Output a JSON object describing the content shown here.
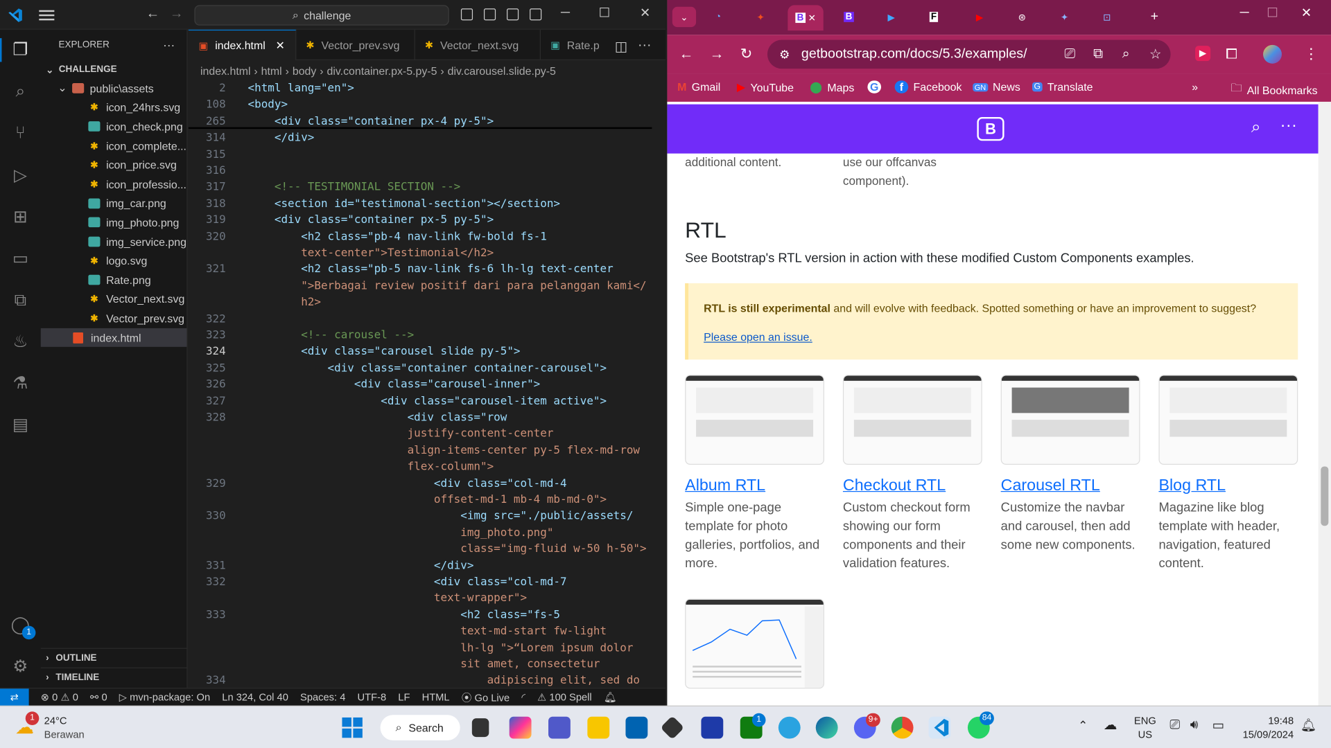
{
  "vscode": {
    "search": "challenge",
    "explorer_title": "EXPLORER",
    "explorer_more": "···",
    "section": "CHALLENGE",
    "folder": "public\\assets",
    "files": [
      {
        "name": "icon_24hrs.svg",
        "kind": "svg"
      },
      {
        "name": "icon_check.png",
        "kind": "png"
      },
      {
        "name": "icon_complete...",
        "kind": "svg"
      },
      {
        "name": "icon_price.svg",
        "kind": "svg"
      },
      {
        "name": "icon_professio...",
        "kind": "svg"
      },
      {
        "name": "img_car.png",
        "kind": "png"
      },
      {
        "name": "img_photo.png",
        "kind": "png"
      },
      {
        "name": "img_service.png",
        "kind": "png"
      },
      {
        "name": "logo.svg",
        "kind": "svg"
      },
      {
        "name": "Rate.png",
        "kind": "png"
      },
      {
        "name": "Vector_next.svg",
        "kind": "svg"
      },
      {
        "name": "Vector_prev.svg",
        "kind": "svg"
      }
    ],
    "root_file": "index.html",
    "outline": "OUTLINE",
    "timeline": "TIMELINE",
    "tabs": [
      "index.html",
      "Vector_prev.svg",
      "Vector_next.svg",
      "Rate.p"
    ],
    "breadcrumbs": [
      "index.html",
      "html",
      "body",
      "div.container.px-5.py-5",
      "div.carousel.slide.py-5"
    ],
    "lines": [
      {
        "n": "2",
        "t": "<html lang=\"en\">"
      },
      {
        "n": "108",
        "t": "<body>"
      },
      {
        "n": "265",
        "t": "    <div class=\"container px-4 py-5\">"
      },
      {
        "n": "314",
        "t": "    </div>"
      },
      {
        "n": "315",
        "t": ""
      },
      {
        "n": "316",
        "t": ""
      },
      {
        "n": "317",
        "t": "    <!-- TESTIMONIAL SECTION -->"
      },
      {
        "n": "318",
        "t": "    <section id=\"testimonal-section\"></section>"
      },
      {
        "n": "319",
        "t": "    <div class=\"container px-5 py-5\">"
      },
      {
        "n": "320",
        "t": "        <h2 class=\"pb-4 nav-link fw-bold fs-1"
      },
      {
        "n": "",
        "t": "        text-center\">Testimonial</h2>"
      },
      {
        "n": "321",
        "t": "        <h2 class=\"pb-5 nav-link fs-6 lh-lg text-center"
      },
      {
        "n": "",
        "t": "        \">Berbagai review positif dari para pelanggan kami</"
      },
      {
        "n": "",
        "t": "        h2>"
      },
      {
        "n": "322",
        "t": ""
      },
      {
        "n": "323",
        "t": "        <!-- carousel -->"
      },
      {
        "n": "324",
        "t": "        <div class=\"carousel slide py-5\">"
      },
      {
        "n": "325",
        "t": "            <div class=\"container container-carousel\">"
      },
      {
        "n": "326",
        "t": "                <div class=\"carousel-inner\">"
      },
      {
        "n": "327",
        "t": "                    <div class=\"carousel-item active\">"
      },
      {
        "n": "328",
        "t": "                        <div class=\"row"
      },
      {
        "n": "",
        "t": "                        justify-content-center"
      },
      {
        "n": "",
        "t": "                        align-items-center py-5 flex-md-row"
      },
      {
        "n": "",
        "t": "                        flex-column\">"
      },
      {
        "n": "329",
        "t": "                            <div class=\"col-md-4"
      },
      {
        "n": "",
        "t": "                            offset-md-1 mb-4 mb-md-0\">"
      },
      {
        "n": "330",
        "t": "                                <img src=\"./public/assets/"
      },
      {
        "n": "",
        "t": "                                img_photo.png\""
      },
      {
        "n": "",
        "t": "                                class=\"img-fluid w-50 h-50\">"
      },
      {
        "n": "331",
        "t": "                            </div>"
      },
      {
        "n": "332",
        "t": "                            <div class=\"col-md-7"
      },
      {
        "n": "",
        "t": "                            text-wrapper\">"
      },
      {
        "n": "333",
        "t": "                                <h2 class=\"fs-5"
      },
      {
        "n": "",
        "t": "                                text-md-start fw-light"
      },
      {
        "n": "",
        "t": "                                lh-lg \">“Lorem ipsum dolor"
      },
      {
        "n": "",
        "t": "                                sit amet, consectetur"
      },
      {
        "n": "334",
        "t": "                                    adipiscing elit, sed do"
      }
    ],
    "status": {
      "errors": "0",
      "warnings": "0",
      "ports": "0",
      "task": "mvn-package: On",
      "position": "Ln 324, Col 40",
      "spaces": "Spaces: 4",
      "encoding": "UTF-8",
      "eol": "LF",
      "language": "HTML",
      "golive": "Go Live",
      "spell": "100 Spell"
    },
    "account_badge": "1"
  },
  "browser": {
    "url": "getbootstrap.com/docs/5.3/examples/",
    "bookmarks": [
      "Gmail",
      "YouTube",
      "Maps",
      "Facebook",
      "News",
      "Translate"
    ],
    "all_bookmarks": "All Bookmarks",
    "old_col1": [
      "additional content."
    ],
    "old_col2": [
      "use our offcanvas",
      "component)."
    ],
    "heading": "RTL",
    "description": "See Bootstrap's RTL version in action with these modified Custom Components examples.",
    "alert_bold": "RTL is still experimental",
    "alert_text": " and will evolve with feedback. Spotted something or have an improvement to suggest?",
    "alert_link": "Please open an issue.",
    "cards": [
      {
        "title": "Album RTL",
        "desc": "Simple one-page template for photo galleries, portfolios, and more."
      },
      {
        "title": "Checkout RTL",
        "desc": "Custom checkout form showing our form components and their validation features."
      },
      {
        "title": "Carousel RTL",
        "desc": "Customize the navbar and carousel, then add some new components."
      },
      {
        "title": "Blog RTL",
        "desc": "Magazine like blog template with header, navigation, featured content."
      }
    ],
    "logo": "B"
  },
  "taskbar": {
    "temp": "24°C",
    "weather": "Berawan",
    "weather_badge": "1",
    "search": "Search",
    "lang1": "ENG",
    "lang2": "US",
    "time": "19:48",
    "date": "15/09/2024",
    "discord_badge": "9+",
    "whatsapp_badge": "84",
    "xbox_badge": "1"
  }
}
